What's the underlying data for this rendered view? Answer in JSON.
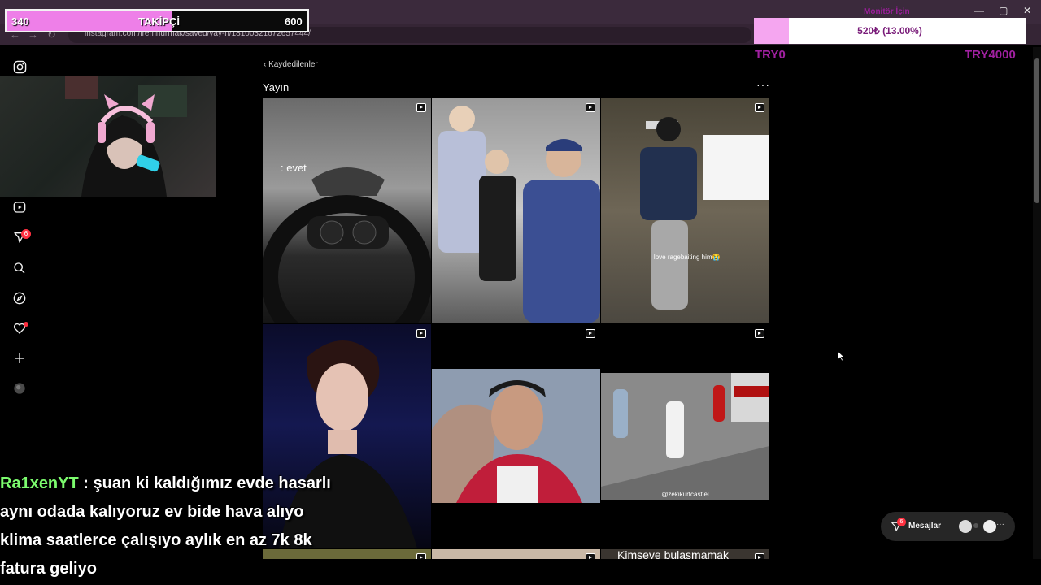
{
  "browser": {
    "url": "instagram.com/iremnurmak/saved/yay-n/18100321672657444/",
    "window_controls": [
      "—",
      "▢",
      "✕"
    ],
    "nav_buttons": [
      "←",
      "→",
      "↻"
    ]
  },
  "overlays": {
    "follower_goal": {
      "current": "340",
      "label": "TAKİPÇİ",
      "target": "600",
      "progress_fraction": 0.55
    },
    "donation_goal": {
      "title": "Monitör İçin",
      "text": "520₺ (13.00%)",
      "min_label": "TRY0",
      "max_label": "TRY4000",
      "progress_fraction": 0.13
    },
    "chat": {
      "username": "Ra1xenYT",
      "separator": " : ",
      "lines": [
        "şuan ki kaldığımız evde hasarlı",
        "aynı odada kalıyoruz ev bide hava alıyo",
        "klima saatlerce çalışıyo aylık en az 7k 8k",
        "fatura geliyo"
      ]
    }
  },
  "sidebar": {
    "items": [
      {
        "icon": "instagram-icon"
      },
      {
        "icon": "reels-icon"
      },
      {
        "icon": "messages-icon",
        "badge": "6"
      },
      {
        "icon": "search-icon"
      },
      {
        "icon": "explore-icon"
      },
      {
        "icon": "notifications-icon"
      },
      {
        "icon": "create-icon"
      },
      {
        "icon": "profile-avatar"
      }
    ]
  },
  "main": {
    "back_label": "Kaydedilenler",
    "collection_title": "Yayın",
    "more_label": "···",
    "posts": [
      {
        "caption": ": evet"
      },
      {
        "caption": ""
      },
      {
        "caption": "I love ragebaiting him😭"
      },
      {
        "caption": ""
      },
      {
        "caption": ""
      },
      {
        "caption": "@zekikurtcastiel"
      },
      {
        "caption": ""
      },
      {
        "caption": ""
      },
      {
        "caption": "Kimseye bulaşmamak"
      }
    ]
  },
  "messages_pill": {
    "label": "Mesajlar",
    "badge": "6"
  },
  "colors": {
    "follower_fill": "#ee7fe8",
    "donation_fill": "#f5a6f0",
    "accent_red": "#ff3040",
    "chat_username": "#7cfc6e"
  }
}
